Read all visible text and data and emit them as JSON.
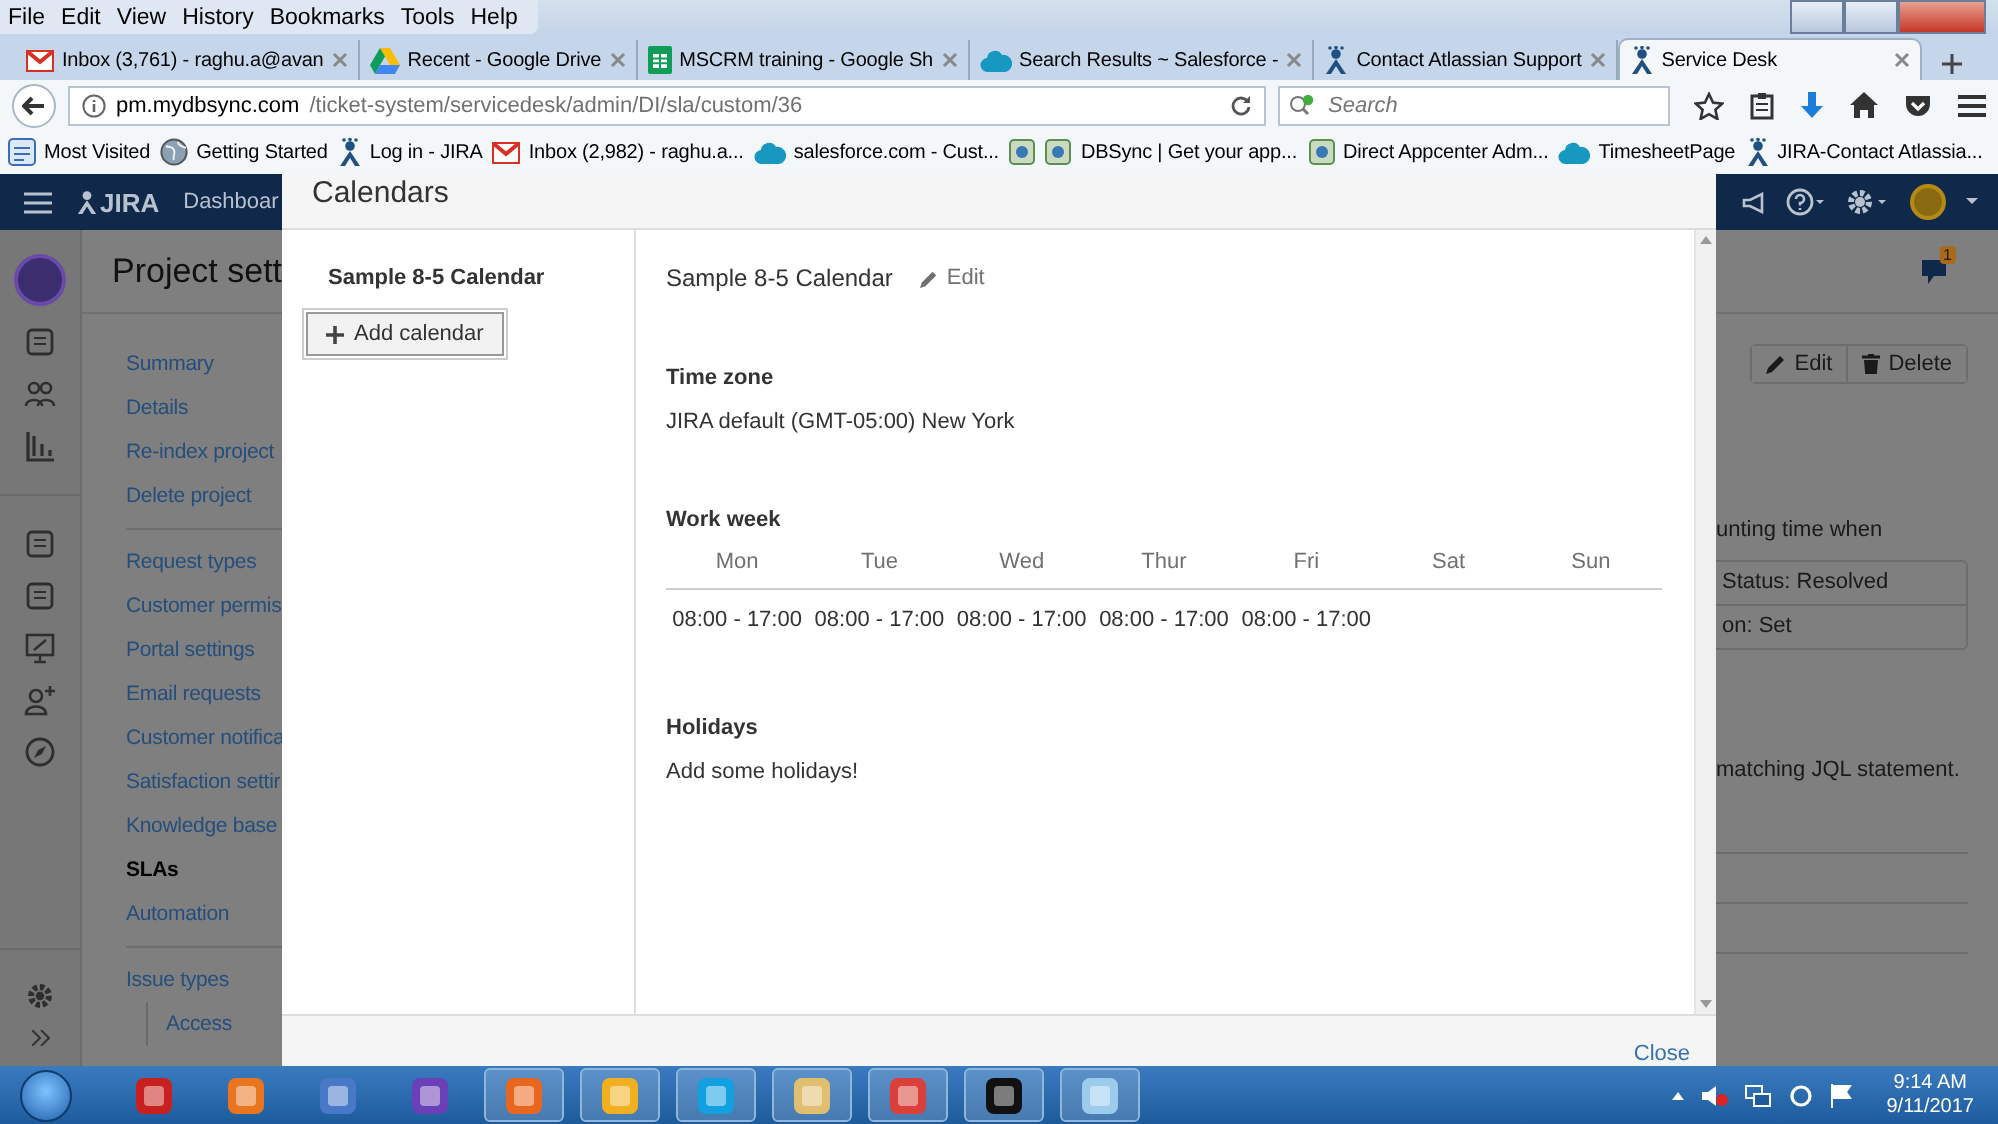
{
  "browser": {
    "menu": [
      "File",
      "Edit",
      "View",
      "History",
      "Bookmarks",
      "Tools",
      "Help"
    ],
    "tabs": [
      {
        "title": "Inbox (3,761) - raghu.a@avan",
        "selected": false
      },
      {
        "title": "Recent - Google Drive",
        "selected": false
      },
      {
        "title": "MSCRM training - Google Sh",
        "selected": false
      },
      {
        "title": "Search Results ~ Salesforce -",
        "selected": false
      },
      {
        "title": "Contact Atlassian Support",
        "selected": false
      },
      {
        "title": "Service Desk",
        "selected": true
      }
    ],
    "address": {
      "host": "pm.mydbsync.com",
      "path": "/ticket-system/servicedesk/admin/DI/sla/custom/36"
    },
    "search": {
      "placeholder": "Search"
    },
    "bookmarks": [
      {
        "label": "Most Visited"
      },
      {
        "label": "Getting Started"
      },
      {
        "label": "Log in - JIRA"
      },
      {
        "label": "Inbox (2,982) - raghu.a..."
      },
      {
        "label": "salesforce.com - Cust..."
      },
      {
        "label": "DBSync | Get your app..."
      },
      {
        "label": "Direct Appcenter Adm..."
      },
      {
        "label": "TimesheetPage"
      },
      {
        "label": "JIRA-Contact Atlassia..."
      }
    ]
  },
  "jira": {
    "logo": "JIRA",
    "nav": "Dashboar",
    "title": "Project sett",
    "notifications": "1",
    "sidebar_sections": [
      {
        "items": [
          {
            "label": "Summary",
            "selected": false
          },
          {
            "label": "Details",
            "selected": false
          },
          {
            "label": "Re-index project",
            "selected": false
          },
          {
            "label": "Delete project",
            "selected": false
          }
        ]
      },
      {
        "items": [
          {
            "label": "Request types",
            "selected": false
          },
          {
            "label": "Customer permis",
            "selected": false
          },
          {
            "label": "Portal settings",
            "selected": false
          },
          {
            "label": "Email requests",
            "selected": false
          },
          {
            "label": "Customer notifica",
            "selected": false
          },
          {
            "label": "Satisfaction settir",
            "selected": false
          },
          {
            "label": "Knowledge base",
            "selected": false
          },
          {
            "label": "SLAs",
            "selected": true
          },
          {
            "label": "Automation",
            "selected": false
          }
        ]
      },
      {
        "items": [
          {
            "label": "Issue types",
            "selected": false,
            "children": [
              {
                "label": "Access",
                "selected": false
              }
            ]
          }
        ]
      }
    ],
    "buttons": [
      "Edit",
      "Delete"
    ],
    "text_1": "unting time when",
    "conditions": [
      "Status: Resolved",
      "on: Set"
    ],
    "text_2": "matching JQL statement."
  },
  "modal": {
    "title": "Calendars",
    "calendars": [
      {
        "name": "Sample 8-5 Calendar",
        "selected": true
      }
    ],
    "add_button": "Add calendar",
    "detail": {
      "name": "Sample 8-5 Calendar",
      "edit": "Edit",
      "time_zone": {
        "label": "Time zone",
        "value": "JIRA default (GMT-05:00) New York"
      },
      "work_week": {
        "label": "Work week",
        "days": [
          {
            "day": "Mon",
            "hours": "08:00 - 17:00"
          },
          {
            "day": "Tue",
            "hours": "08:00 - 17:00"
          },
          {
            "day": "Wed",
            "hours": "08:00 - 17:00"
          },
          {
            "day": "Thur",
            "hours": "08:00 - 17:00"
          },
          {
            "day": "Fri",
            "hours": "08:00 - 17:00"
          },
          {
            "day": "Sat"
          },
          {
            "day": "Sun"
          }
        ]
      },
      "holidays": {
        "label": "Holidays",
        "text": "Add some holidays!"
      }
    },
    "close": "Close"
  },
  "taskbar": {
    "time": "9:14 AM",
    "date": "9/11/2017"
  }
}
